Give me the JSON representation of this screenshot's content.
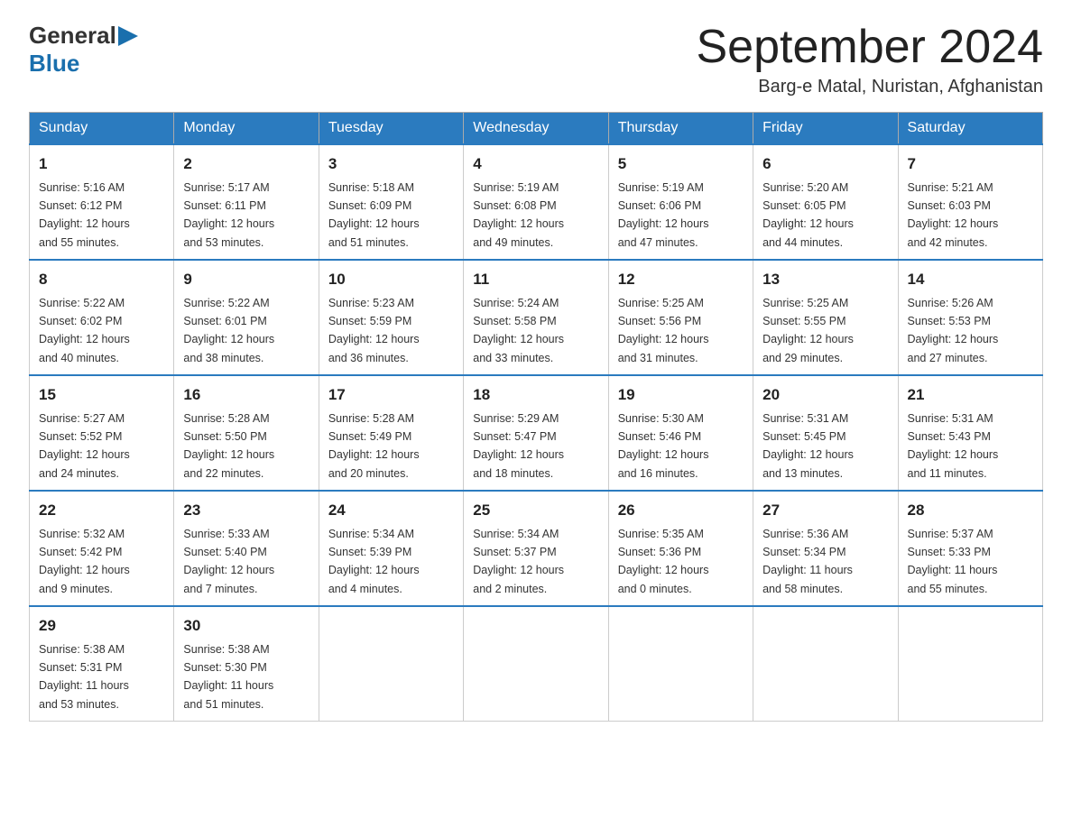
{
  "logo": {
    "general": "General",
    "blue": "Blue"
  },
  "header": {
    "month_year": "September 2024",
    "location": "Barg-e Matal, Nuristan, Afghanistan"
  },
  "days_of_week": [
    "Sunday",
    "Monday",
    "Tuesday",
    "Wednesday",
    "Thursday",
    "Friday",
    "Saturday"
  ],
  "weeks": [
    [
      {
        "day": "1",
        "sunrise": "5:16 AM",
        "sunset": "6:12 PM",
        "daylight": "12 hours and 55 minutes."
      },
      {
        "day": "2",
        "sunrise": "5:17 AM",
        "sunset": "6:11 PM",
        "daylight": "12 hours and 53 minutes."
      },
      {
        "day": "3",
        "sunrise": "5:18 AM",
        "sunset": "6:09 PM",
        "daylight": "12 hours and 51 minutes."
      },
      {
        "day": "4",
        "sunrise": "5:19 AM",
        "sunset": "6:08 PM",
        "daylight": "12 hours and 49 minutes."
      },
      {
        "day": "5",
        "sunrise": "5:19 AM",
        "sunset": "6:06 PM",
        "daylight": "12 hours and 47 minutes."
      },
      {
        "day": "6",
        "sunrise": "5:20 AM",
        "sunset": "6:05 PM",
        "daylight": "12 hours and 44 minutes."
      },
      {
        "day": "7",
        "sunrise": "5:21 AM",
        "sunset": "6:03 PM",
        "daylight": "12 hours and 42 minutes."
      }
    ],
    [
      {
        "day": "8",
        "sunrise": "5:22 AM",
        "sunset": "6:02 PM",
        "daylight": "12 hours and 40 minutes."
      },
      {
        "day": "9",
        "sunrise": "5:22 AM",
        "sunset": "6:01 PM",
        "daylight": "12 hours and 38 minutes."
      },
      {
        "day": "10",
        "sunrise": "5:23 AM",
        "sunset": "5:59 PM",
        "daylight": "12 hours and 36 minutes."
      },
      {
        "day": "11",
        "sunrise": "5:24 AM",
        "sunset": "5:58 PM",
        "daylight": "12 hours and 33 minutes."
      },
      {
        "day": "12",
        "sunrise": "5:25 AM",
        "sunset": "5:56 PM",
        "daylight": "12 hours and 31 minutes."
      },
      {
        "day": "13",
        "sunrise": "5:25 AM",
        "sunset": "5:55 PM",
        "daylight": "12 hours and 29 minutes."
      },
      {
        "day": "14",
        "sunrise": "5:26 AM",
        "sunset": "5:53 PM",
        "daylight": "12 hours and 27 minutes."
      }
    ],
    [
      {
        "day": "15",
        "sunrise": "5:27 AM",
        "sunset": "5:52 PM",
        "daylight": "12 hours and 24 minutes."
      },
      {
        "day": "16",
        "sunrise": "5:28 AM",
        "sunset": "5:50 PM",
        "daylight": "12 hours and 22 minutes."
      },
      {
        "day": "17",
        "sunrise": "5:28 AM",
        "sunset": "5:49 PM",
        "daylight": "12 hours and 20 minutes."
      },
      {
        "day": "18",
        "sunrise": "5:29 AM",
        "sunset": "5:47 PM",
        "daylight": "12 hours and 18 minutes."
      },
      {
        "day": "19",
        "sunrise": "5:30 AM",
        "sunset": "5:46 PM",
        "daylight": "12 hours and 16 minutes."
      },
      {
        "day": "20",
        "sunrise": "5:31 AM",
        "sunset": "5:45 PM",
        "daylight": "12 hours and 13 minutes."
      },
      {
        "day": "21",
        "sunrise": "5:31 AM",
        "sunset": "5:43 PM",
        "daylight": "12 hours and 11 minutes."
      }
    ],
    [
      {
        "day": "22",
        "sunrise": "5:32 AM",
        "sunset": "5:42 PM",
        "daylight": "12 hours and 9 minutes."
      },
      {
        "day": "23",
        "sunrise": "5:33 AM",
        "sunset": "5:40 PM",
        "daylight": "12 hours and 7 minutes."
      },
      {
        "day": "24",
        "sunrise": "5:34 AM",
        "sunset": "5:39 PM",
        "daylight": "12 hours and 4 minutes."
      },
      {
        "day": "25",
        "sunrise": "5:34 AM",
        "sunset": "5:37 PM",
        "daylight": "12 hours and 2 minutes."
      },
      {
        "day": "26",
        "sunrise": "5:35 AM",
        "sunset": "5:36 PM",
        "daylight": "12 hours and 0 minutes."
      },
      {
        "day": "27",
        "sunrise": "5:36 AM",
        "sunset": "5:34 PM",
        "daylight": "11 hours and 58 minutes."
      },
      {
        "day": "28",
        "sunrise": "5:37 AM",
        "sunset": "5:33 PM",
        "daylight": "11 hours and 55 minutes."
      }
    ],
    [
      {
        "day": "29",
        "sunrise": "5:38 AM",
        "sunset": "5:31 PM",
        "daylight": "11 hours and 53 minutes."
      },
      {
        "day": "30",
        "sunrise": "5:38 AM",
        "sunset": "5:30 PM",
        "daylight": "11 hours and 51 minutes."
      },
      null,
      null,
      null,
      null,
      null
    ]
  ]
}
